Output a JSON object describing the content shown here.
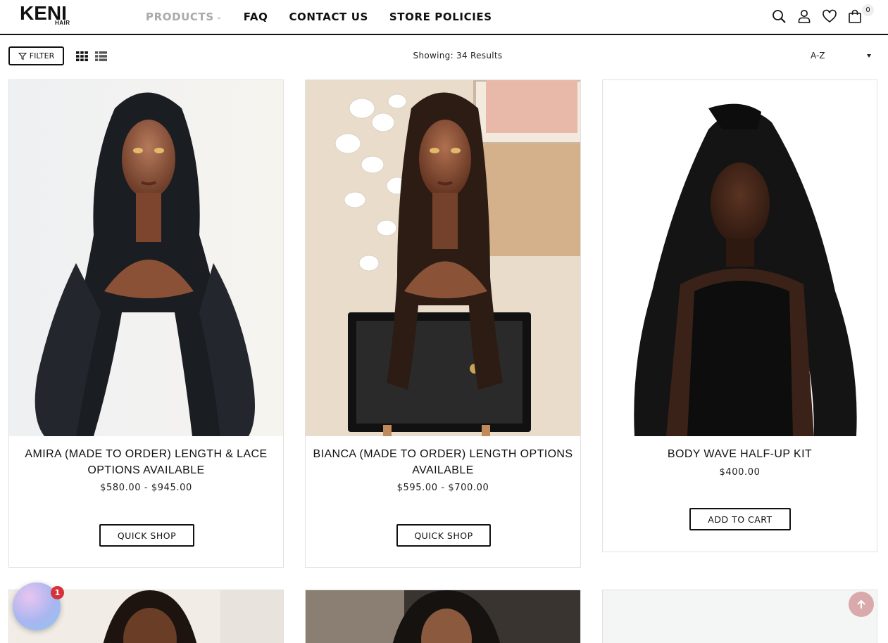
{
  "header": {
    "logo_main": "KENI",
    "logo_sub": "HAIR",
    "nav": [
      {
        "label": "PRODUCTS"
      },
      {
        "label": "FAQ"
      },
      {
        "label": "CONTACT US"
      },
      {
        "label": "STORE POLICIES"
      }
    ],
    "cart_count": "0"
  },
  "toolbar": {
    "filter_label": "FILTER",
    "showing": "Showing: 34 Results",
    "sort_value": "A-Z"
  },
  "products": [
    {
      "title": "AMIRA (MADE TO ORDER) LENGTH & LACE OPTIONS AVAILABLE",
      "price": "$580.00 - $945.00",
      "button": "QUICK SHOP"
    },
    {
      "title": "BIANCA (MADE TO ORDER) LENGTH OPTIONS AVAILABLE",
      "price": "$595.00 - $700.00",
      "button": "QUICK SHOP"
    },
    {
      "title": "BODY WAVE HALF-UP KIT",
      "price": "$400.00",
      "button": "ADD TO CART"
    }
  ],
  "chat": {
    "badge": "1"
  },
  "colors": {
    "accent": "#111111",
    "badge": "#d6323a",
    "scroll_top": "#d9a9ab"
  }
}
